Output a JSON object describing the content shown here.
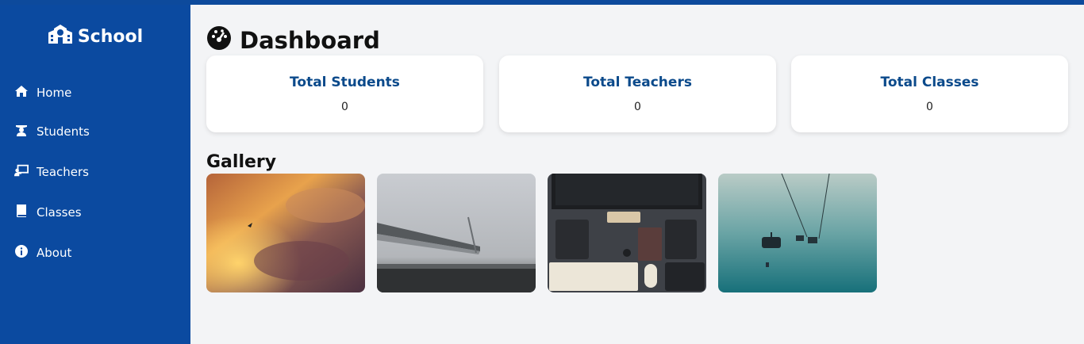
{
  "app": {
    "brand": "School",
    "accent": "#0b4aa0"
  },
  "nav": [
    {
      "label": "Home",
      "icon": "home-icon"
    },
    {
      "label": "Students",
      "icon": "graduate-icon"
    },
    {
      "label": "Teachers",
      "icon": "teacher-icon"
    },
    {
      "label": "Classes",
      "icon": "book-icon"
    },
    {
      "label": "About",
      "icon": "info-icon"
    }
  ],
  "page": {
    "title": "Dashboard",
    "icon": "gauge-icon"
  },
  "stats": [
    {
      "title": "Total Students",
      "value": "0"
    },
    {
      "title": "Total Teachers",
      "value": "0"
    },
    {
      "title": "Total Classes",
      "value": "0"
    }
  ],
  "gallery": {
    "title": "Gallery",
    "images": [
      "sunset-clouds-photo",
      "foggy-bridge-photo",
      "desk-setup-photo",
      "ski-lift-photo"
    ]
  }
}
